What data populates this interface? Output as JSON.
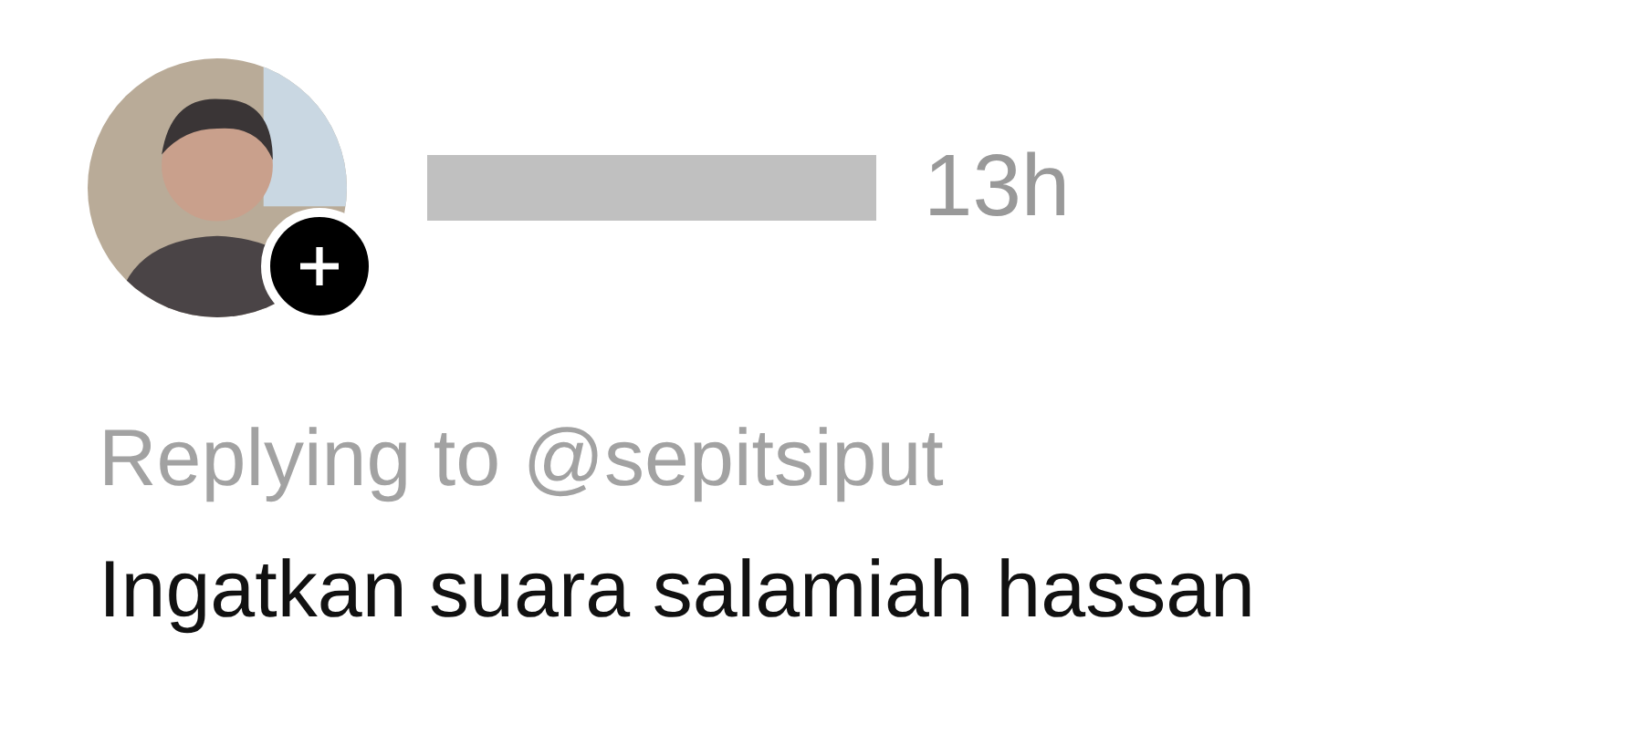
{
  "comment": {
    "time": "13h",
    "reply_to": "Replying to @sepitsiput",
    "text": "Ingatkan suara salamiah hassan"
  }
}
